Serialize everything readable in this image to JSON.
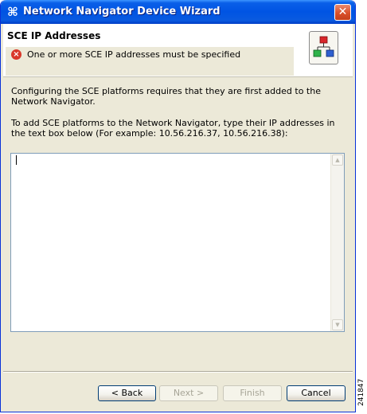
{
  "window": {
    "title": "Network Navigator Device Wizard",
    "close_glyph": "✕",
    "app_icon": "network-navigator-icon"
  },
  "banner": {
    "title": "SCE IP Addresses",
    "message": "One or more SCE IP addresses must be specified",
    "message_icon": "error-icon",
    "graphic_icon": "network-topology-icon",
    "error_color": "#d9382a"
  },
  "content": {
    "para1": "Configuring the SCE platforms requires that they are first added to the Network Navigator.",
    "para2": "To add SCE platforms to the Network Navigator, type their IP addresses in the text box below (For example: 10.56.216.37, 10.56.216.38):",
    "ip_input_value": ""
  },
  "buttons": {
    "back": "< Back",
    "next": "Next >",
    "finish": "Finish",
    "cancel": "Cancel"
  },
  "figure_id": "241847",
  "colors": {
    "titlebar": "#0054e3",
    "dialog_bg": "#ece9d8",
    "border": "#0831d9"
  }
}
